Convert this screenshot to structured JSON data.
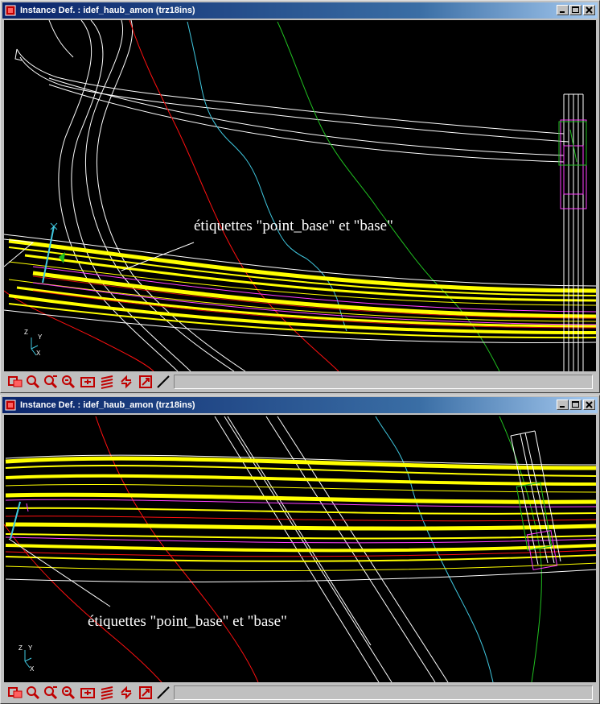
{
  "windows": [
    {
      "title": "Instance Def. : idef_haub_amon (trz18ins)",
      "annotation": "étiquettes \"point_base\" et \"base\"",
      "axes": {
        "z": "Z",
        "y": "Y",
        "x": "X"
      }
    },
    {
      "title": "Instance Def. : idef_haub_amon (trz18ins)",
      "annotation": "étiquettes \"point_base\" et \"base\"",
      "axes": {
        "z": "Z",
        "y": "Y",
        "x": "X"
      }
    }
  ],
  "colors": {
    "road": "#ffff00",
    "red_line": "#ff1010",
    "cyan_line": "#40c8e0",
    "green_line": "#20c020",
    "magenta": "#ff40ff",
    "white": "#ffffff"
  },
  "toolbar_icons": [
    "zoom-window-icon",
    "zoom-in-icon",
    "zoom-out-icon",
    "zoom-all-icon",
    "pan-icon",
    "layers-icon",
    "redraw-icon",
    "view-icon",
    "line-tool-icon"
  ]
}
